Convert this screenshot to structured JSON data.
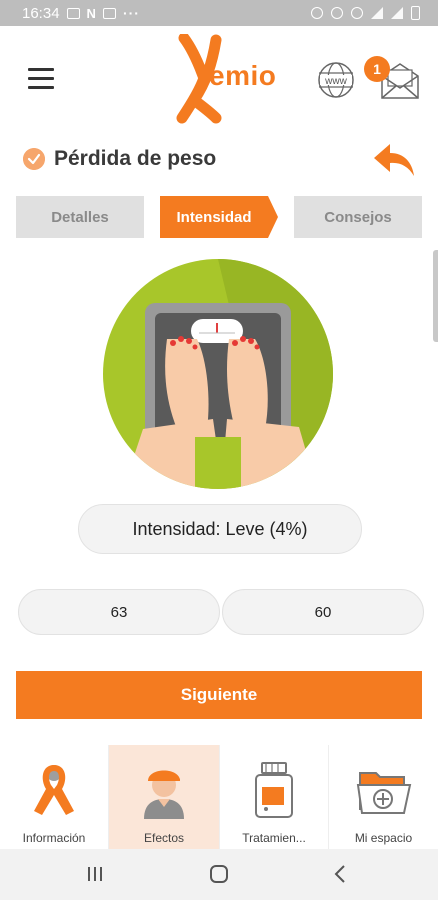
{
  "status_bar": {
    "time": "16:34",
    "n_icon": "N",
    "more": "···"
  },
  "header": {
    "logo_text": "emio",
    "www_label": "www",
    "mail_badge": "1"
  },
  "page": {
    "title": "Pérdida de peso"
  },
  "tabs": [
    {
      "label": "Detalles",
      "active": false
    },
    {
      "label": "Intensidad",
      "active": true
    },
    {
      "label": "Consejos",
      "active": false
    }
  ],
  "intensity": {
    "text": "Intensidad: Leve (4%)"
  },
  "values": {
    "first": "63",
    "second": "60"
  },
  "next_button": {
    "label": "Siguiente"
  },
  "bottom_nav": [
    {
      "label": "Información",
      "icon": "ribbon-icon"
    },
    {
      "label": "Efectos",
      "icon": "person-icon",
      "selected": true
    },
    {
      "label": "Tratamien...",
      "icon": "medicine-bottle-icon"
    },
    {
      "label": "Mi espacio",
      "icon": "folder-plus-icon"
    }
  ],
  "colors": {
    "accent": "#f47b20",
    "tab_inactive": "#e0e0e0",
    "selected_nav": "#fbe6d8",
    "illustration_bg": "#a8c62a"
  }
}
